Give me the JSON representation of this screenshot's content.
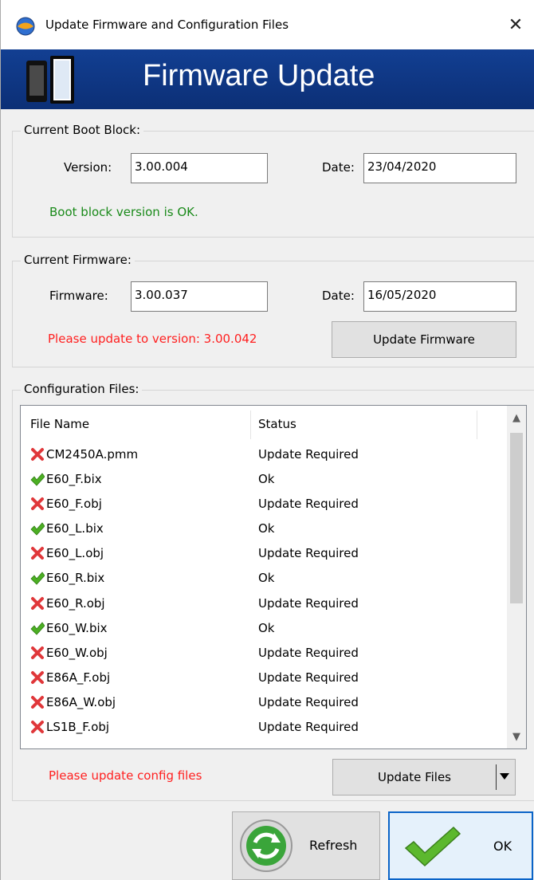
{
  "window": {
    "title": "Update Firmware and Configuration Files",
    "close_glyph": "✕",
    "icon": "app-globe-icon"
  },
  "banner": {
    "title": "Firmware Update",
    "icon": "device-icon",
    "colors": {
      "background": "#123f92",
      "text": "#ffffff"
    }
  },
  "boot_block": {
    "legend": "Current Boot Block:",
    "version_label": "Version:",
    "version_value": "3.00.004",
    "date_label": "Date:",
    "date_value": "23/04/2020",
    "status_message": "Boot block version is OK.",
    "status_color": "#1a8a1a"
  },
  "firmware": {
    "legend": "Current Firmware:",
    "firmware_label": "Firmware:",
    "firmware_value": "3.00.037",
    "date_label": "Date:",
    "date_value": "16/05/2020",
    "status_message": "Please update to version: 3.00.042",
    "status_color": "#ff1f1f",
    "update_button": "Update Firmware"
  },
  "config_files": {
    "legend": "Configuration Files:",
    "columns": [
      "File Name",
      "Status"
    ],
    "rows": [
      {
        "name": "CM2450A.pmm",
        "status": "Update Required",
        "icon": "red-x-icon"
      },
      {
        "name": "E60_F.bix",
        "status": "Ok",
        "icon": "green-check-icon"
      },
      {
        "name": "E60_F.obj",
        "status": "Update Required",
        "icon": "red-x-icon"
      },
      {
        "name": "E60_L.bix",
        "status": "Ok",
        "icon": "green-check-icon"
      },
      {
        "name": "E60_L.obj",
        "status": "Update Required",
        "icon": "red-x-icon"
      },
      {
        "name": "E60_R.bix",
        "status": "Ok",
        "icon": "green-check-icon"
      },
      {
        "name": "E60_R.obj",
        "status": "Update Required",
        "icon": "red-x-icon"
      },
      {
        "name": "E60_W.bix",
        "status": "Ok",
        "icon": "green-check-icon"
      },
      {
        "name": "E60_W.obj",
        "status": "Update Required",
        "icon": "red-x-icon"
      },
      {
        "name": "E86A_F.obj",
        "status": "Update Required",
        "icon": "red-x-icon"
      },
      {
        "name": "E86A_W.obj",
        "status": "Update Required",
        "icon": "red-x-icon"
      },
      {
        "name": "LS1B_F.obj",
        "status": "Update Required",
        "icon": "red-x-icon"
      }
    ],
    "status_message": "Please update config files",
    "update_button": "Update Files"
  },
  "footer": {
    "refresh_button": "Refresh",
    "ok_button": "OK"
  }
}
